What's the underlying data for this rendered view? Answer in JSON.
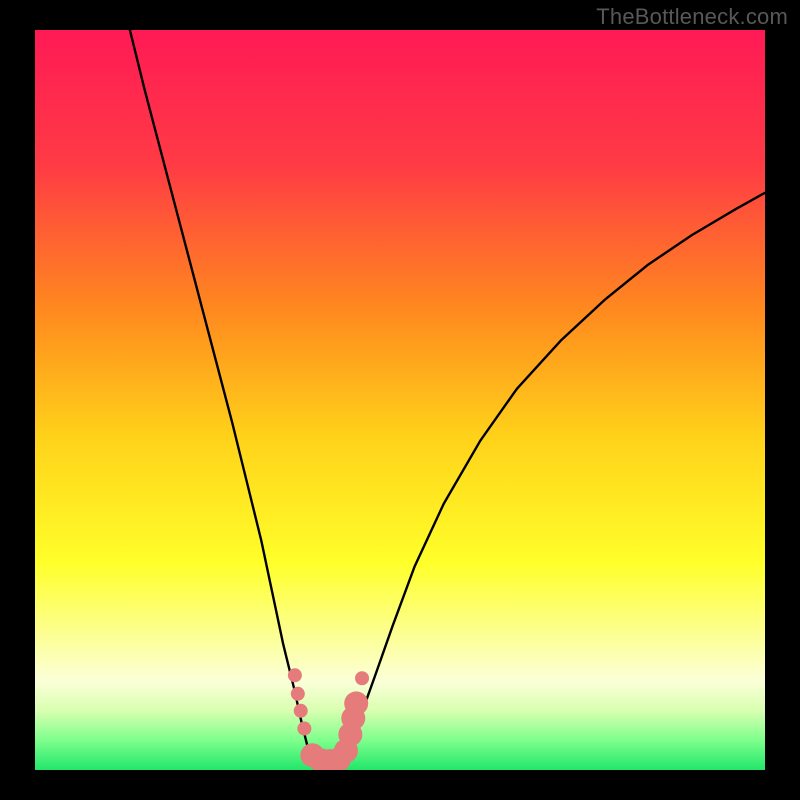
{
  "watermark": "TheBottleneck.com",
  "chart_data": {
    "type": "line",
    "title": "",
    "xlabel": "",
    "ylabel": "",
    "xlim": [
      0,
      100
    ],
    "ylim": [
      0,
      100
    ],
    "gradient_stops": [
      {
        "offset": 0,
        "color": "#ff1a55"
      },
      {
        "offset": 18,
        "color": "#ff3a45"
      },
      {
        "offset": 38,
        "color": "#ff8a1e"
      },
      {
        "offset": 55,
        "color": "#ffd21a"
      },
      {
        "offset": 72,
        "color": "#ffff2a"
      },
      {
        "offset": 83,
        "color": "#fcffa0"
      },
      {
        "offset": 88,
        "color": "#fbffd8"
      },
      {
        "offset": 92,
        "color": "#d8ffb0"
      },
      {
        "offset": 96,
        "color": "#7dff8c"
      },
      {
        "offset": 100,
        "color": "#22e66b"
      }
    ],
    "series": [
      {
        "name": "left-branch",
        "x": [
          13,
          15,
          17,
          19,
          21,
          23,
          25,
          27,
          29,
          31,
          32.5,
          34,
          35.5,
          36.5,
          37.3,
          38
        ],
        "y": [
          100,
          92,
          84.5,
          77,
          69.5,
          62,
          54.5,
          47,
          39,
          31,
          24,
          17,
          11,
          6.5,
          3.3,
          1.5
        ]
      },
      {
        "name": "right-branch",
        "x": [
          42,
          43,
          44.5,
          46.5,
          49,
          52,
          56,
          61,
          66,
          72,
          78,
          84,
          90,
          96,
          100
        ],
        "y": [
          1.5,
          3.5,
          7,
          12.5,
          19.5,
          27.5,
          36,
          44.5,
          51.5,
          58,
          63.5,
          68.3,
          72.3,
          75.8,
          78
        ]
      }
    ],
    "valley_floor": {
      "x": [
        38,
        39,
        40,
        41,
        42
      ],
      "y": [
        1.5,
        1.0,
        0.9,
        1.0,
        1.5
      ]
    },
    "markers": {
      "color": "#e57b7b",
      "radius_small": 7,
      "radius_large": 12,
      "points": [
        {
          "x": 35.6,
          "y": 12.8,
          "r": 7
        },
        {
          "x": 36.0,
          "y": 10.3,
          "r": 7
        },
        {
          "x": 36.4,
          "y": 8.0,
          "r": 7
        },
        {
          "x": 36.9,
          "y": 5.6,
          "r": 7
        },
        {
          "x": 38.0,
          "y": 2.0,
          "r": 12
        },
        {
          "x": 39.2,
          "y": 1.3,
          "r": 12
        },
        {
          "x": 40.4,
          "y": 1.2,
          "r": 12
        },
        {
          "x": 41.6,
          "y": 1.4,
          "r": 12
        },
        {
          "x": 42.6,
          "y": 2.6,
          "r": 12
        },
        {
          "x": 43.2,
          "y": 4.8,
          "r": 12
        },
        {
          "x": 43.6,
          "y": 7.0,
          "r": 12
        },
        {
          "x": 44.0,
          "y": 9.0,
          "r": 12
        },
        {
          "x": 44.8,
          "y": 12.4,
          "r": 7
        }
      ]
    }
  }
}
